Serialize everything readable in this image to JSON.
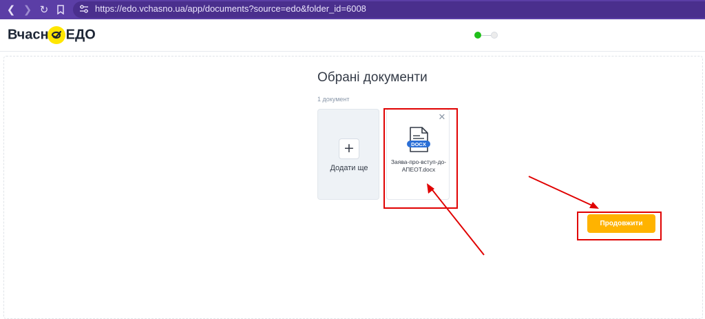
{
  "browser": {
    "url": "https://edo.vchasno.ua/app/documents?source=edo&folder_id=6008",
    "icons": [
      "back-icon",
      "forward-icon",
      "reload-icon",
      "bookmark-icon",
      "site-settings-icon"
    ]
  },
  "header": {
    "logo_left": "Вчасн",
    "logo_right": "ЕДО",
    "stepper": {
      "total_steps": 2,
      "current_step": 1
    }
  },
  "main": {
    "title": "Обрані документи",
    "count_label": "1 документ",
    "add_tile": {
      "icon": "plus-icon",
      "label": "Додати ще"
    },
    "documents": [
      {
        "name": "Заява-про-вступ-до-АПЕОТ.docx",
        "badge": "DOCX",
        "icon": "docx-file-icon",
        "close": "close-icon"
      }
    ],
    "continue_label": "Продовжити"
  },
  "colors": {
    "browser_bar": "#5b3ea6",
    "logo_accent": "#ffe600",
    "step_active": "#1fbf1a",
    "primary_button": "#ffb300",
    "annotation": "#e00000",
    "docx_badge": "#2b6fd6"
  }
}
